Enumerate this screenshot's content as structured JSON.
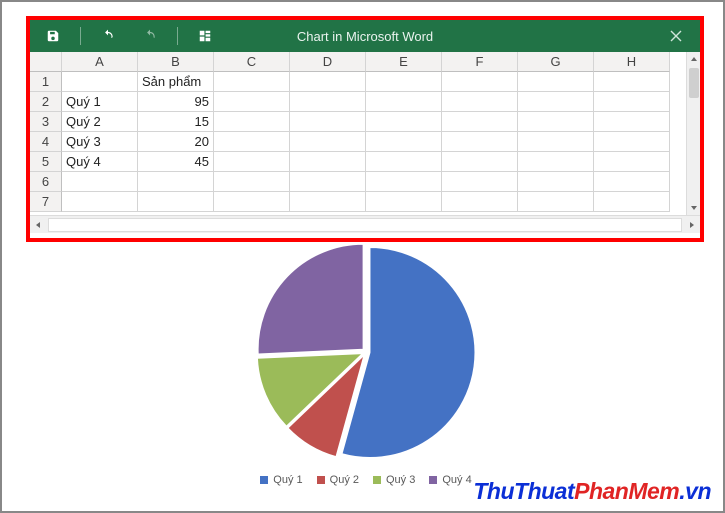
{
  "window": {
    "title": "Chart in Microsoft Word"
  },
  "sheet": {
    "columns": [
      "A",
      "B",
      "C",
      "D",
      "E",
      "F",
      "G",
      "H"
    ],
    "row_numbers": [
      "1",
      "2",
      "3",
      "4",
      "5",
      "6",
      "7"
    ],
    "cells": {
      "B1": "Sản phẩm",
      "A2": "Quý 1",
      "B2": "95",
      "A3": "Quý 2",
      "B3": "15",
      "A4": "Quý 3",
      "B4": "20",
      "A5": "Quý 4",
      "B5": "45"
    }
  },
  "legend": {
    "items": [
      {
        "label": "Quý 1",
        "color": "#4472C4"
      },
      {
        "label": "Quý 2",
        "color": "#C0504D"
      },
      {
        "label": "Quý 3",
        "color": "#9BBB59"
      },
      {
        "label": "Quý 4",
        "color": "#8064A2"
      }
    ]
  },
  "chart_data": {
    "type": "pie",
    "title": "",
    "series_name": "Sản phẩm",
    "categories": [
      "Quý 1",
      "Quý 2",
      "Quý 3",
      "Quý 4"
    ],
    "values": [
      95,
      15,
      20,
      45
    ],
    "colors": [
      "#4472C4",
      "#C0504D",
      "#9BBB59",
      "#8064A2"
    ]
  },
  "watermark": {
    "part1": "ThuThuat",
    "part2": "PhanMem",
    "part3": ".vn"
  }
}
